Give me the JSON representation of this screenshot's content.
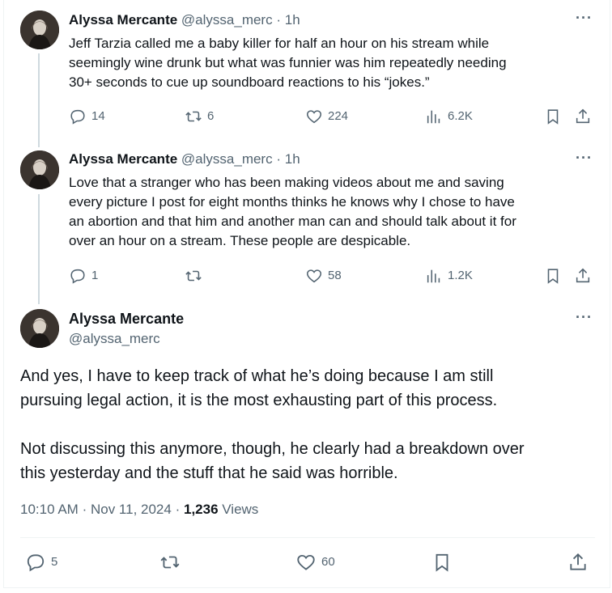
{
  "tweets": [
    {
      "name": "Alyssa Mercante",
      "handle": "@alyssa_merc",
      "time": "1h",
      "separator": "·",
      "more": "···",
      "lines": [
        "Jeff Tarzia called me a baby killer for half an hour on his stream while",
        "seemingly wine drunk but what was funnier was him repeatedly needing",
        "30+ seconds to cue up soundboard reactions to his “jokes.”"
      ],
      "replies": "14",
      "reposts": "6",
      "likes": "224",
      "views": "6.2K"
    },
    {
      "name": "Alyssa Mercante",
      "handle": "@alyssa_merc",
      "time": "1h",
      "separator": "·",
      "more": "···",
      "lines": [
        "Love that a stranger who has been making videos about me and saving",
        "every picture I post for eight months thinks he knows why I chose to have",
        "an abortion and that him and another man can and should talk about it for",
        "over an hour on a stream. These people are despicable."
      ],
      "replies": "1",
      "reposts": "",
      "likes": "58",
      "views": "1.2K"
    }
  ],
  "main": {
    "name": "Alyssa Mercante",
    "handle": "@alyssa_merc",
    "more": "···",
    "para1": [
      "And yes, I have to keep track of what he’s doing because I am still",
      "pursuing legal action, it is the most exhausting part of this process."
    ],
    "para2": [
      "Not discussing this anymore, though, he clearly had a breakdown over",
      "this yesterday and the stuff that he said was horrible."
    ],
    "time": "10:10 AM",
    "date": "Nov 11, 2024",
    "dot": "·",
    "views_count": "1,236",
    "views_label": "Views",
    "replies": "5",
    "reposts": "",
    "likes": "60"
  },
  "icons": {
    "reply": "reply-icon",
    "repost": "repost-icon",
    "like": "like-icon",
    "views": "views-icon",
    "bookmark": "bookmark-icon",
    "share": "share-icon"
  },
  "colors": {
    "text": "#0f1419",
    "secondary": "#536471",
    "thread_line": "#cfd9de",
    "divider": "#eff3f4"
  }
}
